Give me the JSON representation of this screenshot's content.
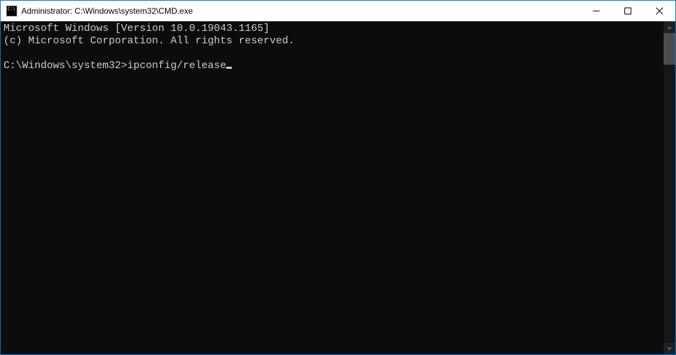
{
  "titlebar": {
    "title": "Administrator: C:\\Windows\\system32\\CMD.exe"
  },
  "terminal": {
    "line1": "Microsoft Windows [Version 10.0.19043.1165]",
    "line2": "(c) Microsoft Corporation. All rights reserved.",
    "blank": "",
    "prompt": "C:\\Windows\\system32>",
    "command": "ipconfig/release"
  }
}
